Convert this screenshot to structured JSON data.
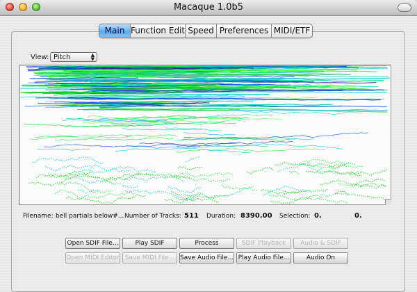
{
  "window": {
    "title": "Macaque 1.0b5"
  },
  "tabs": [
    {
      "label": "Main",
      "active": true
    },
    {
      "label": "Function Editor",
      "active": false
    },
    {
      "label": "Speed",
      "active": false
    },
    {
      "label": "Preferences",
      "active": false
    },
    {
      "label": "MIDI/ETF",
      "active": false
    }
  ],
  "view": {
    "label": "View:",
    "selected": "Pitch"
  },
  "info": {
    "filename_label": "Filename:",
    "filename_value": "bell partials below#...",
    "tracks_label": "Number of Tracks:",
    "tracks_value": "511",
    "duration_label": "Duration:",
    "duration_value": "8390.00",
    "selection_label": "Selection:",
    "selection_start": "0.",
    "selection_end": "0."
  },
  "buttons": {
    "row1": [
      {
        "label": "Open SDIF File...",
        "enabled": true
      },
      {
        "label": "Play SDIF",
        "enabled": true
      },
      {
        "label": "Process",
        "enabled": true
      },
      {
        "label": "SDIF Playback",
        "enabled": false
      },
      {
        "label": "Audio & SDIF",
        "enabled": false
      }
    ],
    "row2": [
      {
        "label": "Open MIDI Editor",
        "enabled": false
      },
      {
        "label": "Save MIDI File...",
        "enabled": false
      },
      {
        "label": "Save Audio File...",
        "enabled": true
      },
      {
        "label": "Play Audio File...",
        "enabled": true
      },
      {
        "label": "Audio On",
        "enabled": true
      }
    ]
  },
  "colors": {
    "track_colors": [
      "#00d000",
      "#22e040",
      "#00c8c0",
      "#1aa8e0",
      "#0044d8",
      "#2a2aa0",
      "#40ff40",
      "#00e0a0"
    ],
    "tab_active": "#5da8ec"
  }
}
